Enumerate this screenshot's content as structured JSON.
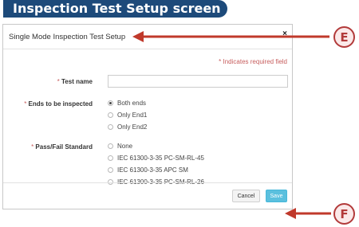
{
  "banner": {
    "title": "Inspection Test Setup screen"
  },
  "dialog": {
    "title": "Single Mode Inspection Test Setup",
    "close_glyph": "×",
    "required_note": "* Indicates required field",
    "fields": {
      "test_name": {
        "star": "* ",
        "label": "Test name",
        "value": ""
      },
      "ends": {
        "star": "* ",
        "label": "Ends to be inspected",
        "options": [
          "Both ends",
          "Only End1",
          "Only End2"
        ],
        "selected": "Both ends"
      },
      "pass_fail": {
        "star": "* ",
        "label": "Pass/Fail Standard",
        "options": [
          "None",
          "IEC 61300-3-35 PC-SM-RL-45",
          "IEC 61300-3-35 APC SM",
          "IEC 61300-3-35 PC-SM-RL-26"
        ],
        "selected": ""
      }
    },
    "buttons": {
      "cancel": "Cancel",
      "save": "Save"
    }
  },
  "callouts": {
    "e": "E",
    "f": "F"
  },
  "colors": {
    "banner": "#1d4a7a",
    "accent_red": "#c0392b",
    "save_button": "#5bc0de",
    "required": "#c75d5d"
  }
}
